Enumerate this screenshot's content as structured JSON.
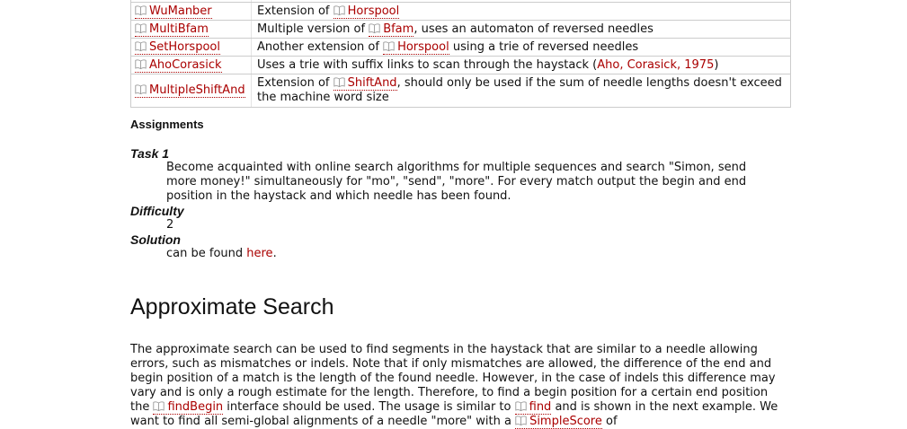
{
  "table": {
    "rows": [
      {
        "name": "WuManber",
        "desc": [
          {
            "t": "text",
            "v": "Extension of "
          },
          {
            "t": "link",
            "v": "Horspool"
          }
        ]
      },
      {
        "name": "MultiBfam",
        "desc": [
          {
            "t": "text",
            "v": "Multiple version of "
          },
          {
            "t": "link",
            "v": "Bfam"
          },
          {
            "t": "text",
            "v": ", uses an automaton of reversed needles"
          }
        ]
      },
      {
        "name": "SetHorspool",
        "desc": [
          {
            "t": "text",
            "v": "Another extension of "
          },
          {
            "t": "link",
            "v": "Horspool"
          },
          {
            "t": "text",
            "v": " using a trie of reversed needles"
          }
        ]
      },
      {
        "name": "AhoCorasick",
        "desc": [
          {
            "t": "text",
            "v": "Uses a trie with suffix links to scan through the haystack ("
          },
          {
            "t": "plainlink",
            "v": "Aho, Corasick, 1975"
          },
          {
            "t": "text",
            "v": ")"
          }
        ]
      },
      {
        "name": "MultipleShiftAnd",
        "desc": [
          {
            "t": "text",
            "v": "Extension of "
          },
          {
            "t": "link",
            "v": "ShiftAnd"
          },
          {
            "t": "text",
            "v": ", should only be used if the sum of needle lengths doesn't exceed the machine word size"
          }
        ]
      }
    ]
  },
  "assignments": {
    "heading": "Assignments",
    "task_label": "Task 1",
    "task_text": "Become acquainted with online search algorithms for multiple sequences and search \"Simon, send more money!\" simultaneously for \"mo\", \"send\", \"more\". For every match output the begin and end position in the haystack and which needle has been found.",
    "difficulty_label": "Difficulty",
    "difficulty_value": "2",
    "solution_label": "Solution",
    "solution_prefix": "can be found ",
    "solution_link": "here",
    "solution_suffix": "."
  },
  "approx": {
    "title": "Approximate Search",
    "para": [
      {
        "t": "text",
        "v": "The approximate search can be used to find segments in the haystack that are similar to a needle allowing errors, such as mismatches or indels. Note that if only mismatches are allowed, the difference of the end and begin position of a match is the length of the found needle. However, in the case of indels this difference may vary and is only a rough estimate for the length. Therefore, to find a begin position for a certain end position the "
      },
      {
        "t": "link",
        "v": "findBegin"
      },
      {
        "t": "text",
        "v": " interface should be used. The usage is similar to "
      },
      {
        "t": "link",
        "v": "find"
      },
      {
        "t": "text",
        "v": " and is shown in the next example. We want to find all semi-global alignments of a needle \"more\" with a "
      },
      {
        "t": "link",
        "v": "SimpleScore"
      },
      {
        "t": "text",
        "v": " of"
      }
    ]
  },
  "colors": {
    "link": "#aa0000",
    "text": "#111111",
    "border": "#cccccc"
  },
  "icon": "book-icon"
}
